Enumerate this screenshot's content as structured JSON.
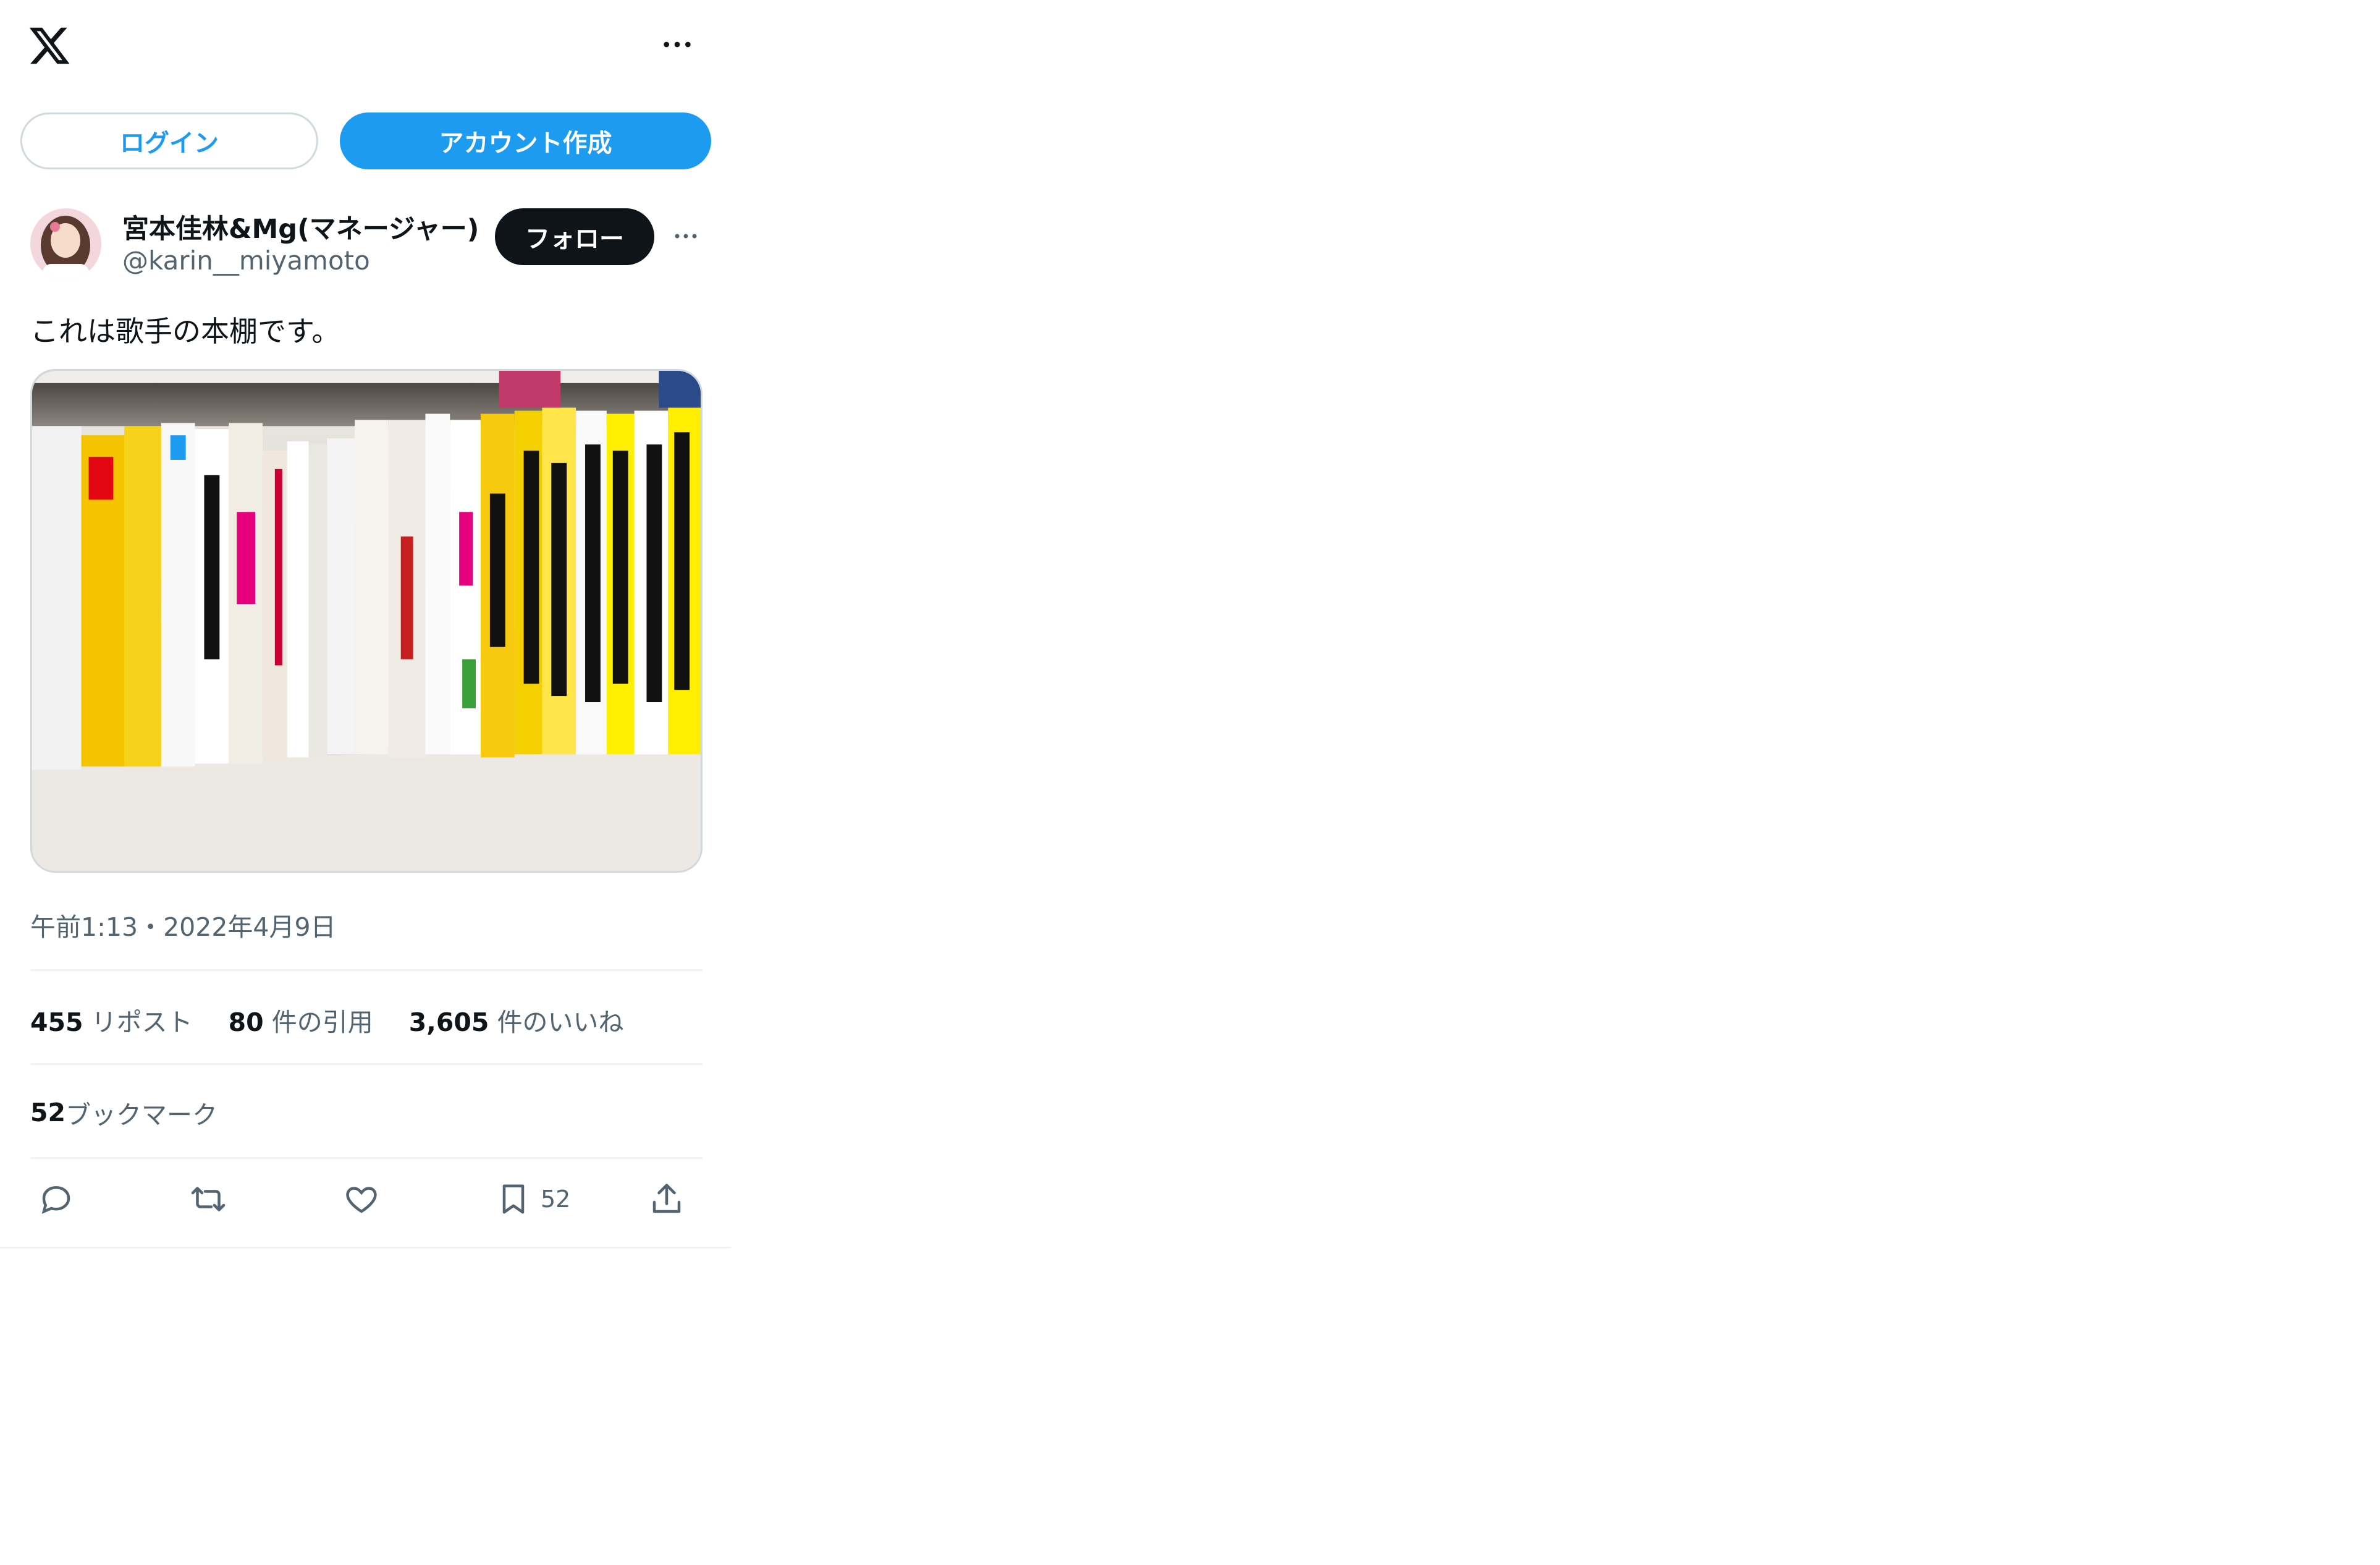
{
  "header": {
    "logo_icon": "x-logo-icon",
    "more_icon": "more-horizontal-icon"
  },
  "auth": {
    "login_label": "ログイン",
    "signup_label": "アカウント作成"
  },
  "tweet": {
    "author": {
      "display_name": "宮本佳林&Mg(マネージャー)",
      "handle": "@karin__miyamoto"
    },
    "follow_label": "フォロー",
    "text": "これは歌手の本棚です。",
    "timestamp": "午前1:13・2022年4月9日",
    "stats": {
      "reposts_count": "455",
      "reposts_label": "リポスト",
      "quotes_count": "80",
      "quotes_label": "件の引用",
      "likes_count": "3,605",
      "likes_label": "件のいいね",
      "bookmarks_count": "52",
      "bookmarks_label": "ブックマーク"
    },
    "actions": {
      "bookmark_count": "52"
    }
  },
  "colors": {
    "accent": "#1d9bf0",
    "text_primary": "#0f1419",
    "text_secondary": "#536471",
    "border": "#cfd9de"
  }
}
